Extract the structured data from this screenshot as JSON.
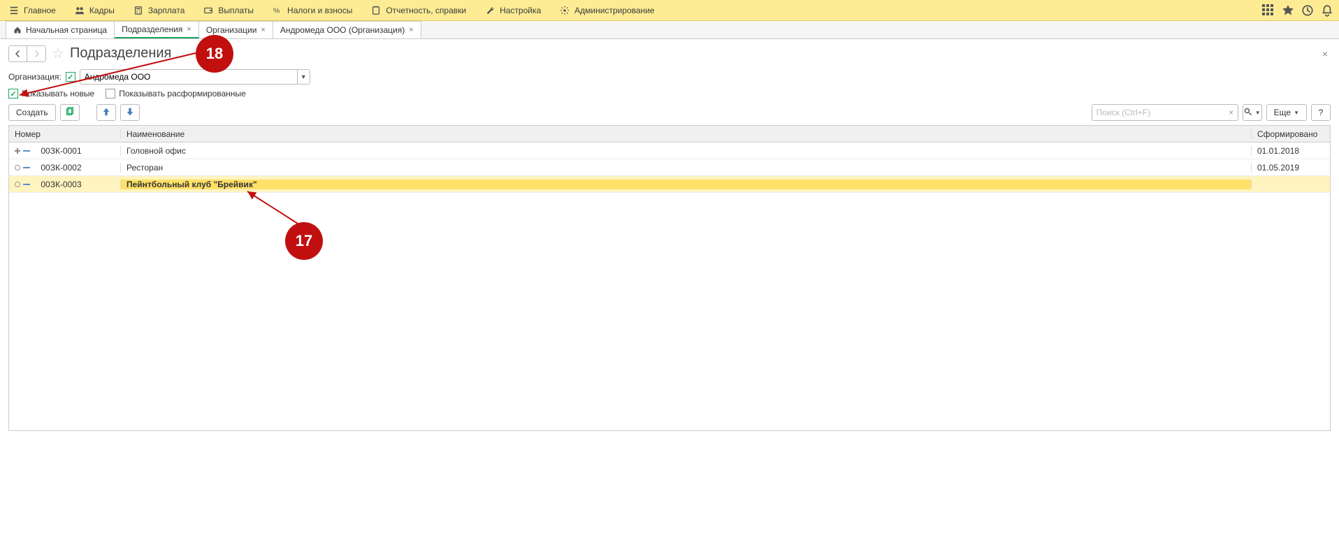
{
  "topmenu": {
    "items": [
      {
        "label": "Главное"
      },
      {
        "label": "Кадры"
      },
      {
        "label": "Зарплата"
      },
      {
        "label": "Выплаты"
      },
      {
        "label": "Налоги и взносы"
      },
      {
        "label": "Отчетность, справки"
      },
      {
        "label": "Настройка"
      },
      {
        "label": "Администрирование"
      }
    ]
  },
  "tabs": [
    {
      "label": "Начальная страница",
      "home": true,
      "closable": false
    },
    {
      "label": "Подразделения",
      "active": true,
      "closable": true
    },
    {
      "label": "Организации",
      "closable": true
    },
    {
      "label": "Андромеда ООО (Организация)",
      "closable": true
    }
  ],
  "page": {
    "title": "Подразделения",
    "org_label": "Организация:",
    "org_value": "Андромеда ООО",
    "show_new_label": "Показывать новые",
    "show_disbanded_label": "Показывать расформированные"
  },
  "toolbar": {
    "create_label": "Создать",
    "more_label": "Еще",
    "help_label": "?",
    "search_placeholder": "Поиск (Ctrl+F)"
  },
  "table": {
    "headers": {
      "num": "Номер",
      "name": "Наименование",
      "date": "Сформировано"
    },
    "rows": [
      {
        "num": "00ЗК-0001",
        "name": "Головной офис",
        "date": "01.01.2018",
        "expandable": true
      },
      {
        "num": "00ЗК-0002",
        "name": "Ресторан",
        "date": "01.05.2019"
      },
      {
        "num": "00ЗК-0003",
        "name": "Пейнтбольный клуб \"Брейвик\"",
        "date": "",
        "selected": true
      }
    ]
  },
  "annotations": {
    "m17": "17",
    "m18": "18"
  }
}
